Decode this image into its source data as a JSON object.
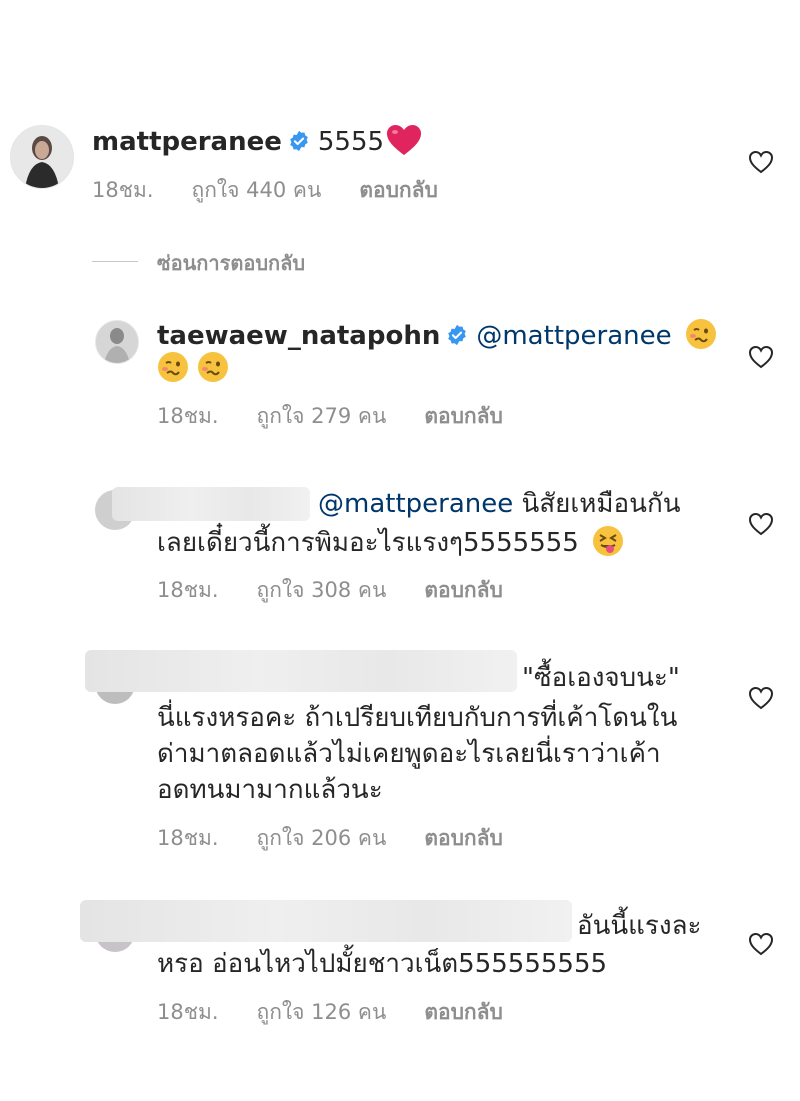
{
  "comments": [
    {
      "username": "mattperanee",
      "text": "5555",
      "time": "18ชม.",
      "likes": "ถูกใจ 440 คน",
      "reply": "ตอบกลับ"
    },
    {
      "username": "taewaew_natapohn",
      "mention": "@mattperanee",
      "time": "18ชม.",
      "likes": "ถูกใจ 279 คน",
      "reply": "ตอบกลับ"
    },
    {
      "mention": "@mattperanee",
      "line1": "นิสัยเหมือนกัน",
      "line2": "เลยเดี๋ยวนี้การพิมอะไรแรงๆ5555555",
      "time": "18ชม.",
      "likes": "ถูกใจ 308 คน",
      "reply": "ตอบกลับ"
    },
    {
      "line1": "\"ซื้อเองจบนะ\"",
      "line2": "นี่แรงหรอคะ ถ้าเปรียบเทียบกับการที่เค้าโดนใน",
      "line3": "ด่ามาตลอดแล้วไม่เคยพูดอะไรเลยนี่เราว่าเค้า",
      "line4": "อดทนมามากแล้วนะ",
      "time": "18ชม.",
      "likes": "ถูกใจ 206 คน",
      "reply": "ตอบกลับ"
    },
    {
      "line1": "อันนี้แรงละ",
      "line2": "หรอ อ่อนไหวไปมั้ยชาวเน็ต555555555",
      "time": "18ชม.",
      "likes": "ถูกใจ 126 คน",
      "reply": "ตอบกลับ"
    }
  ],
  "hide_replies": "ซ่อนการตอบกลับ",
  "icons": {
    "verified": "verified-badge-icon",
    "like": "heart-outline-icon",
    "heart_emoji": "red-heart-emoji",
    "woozy_emoji": "woozy-face-emoji",
    "tongue_emoji": "squinting-tongue-emoji"
  },
  "colors": {
    "verified": "#3897f0",
    "mention": "#00376b",
    "meta": "#8e8e8e",
    "heart_emoji": "#e0245e"
  }
}
